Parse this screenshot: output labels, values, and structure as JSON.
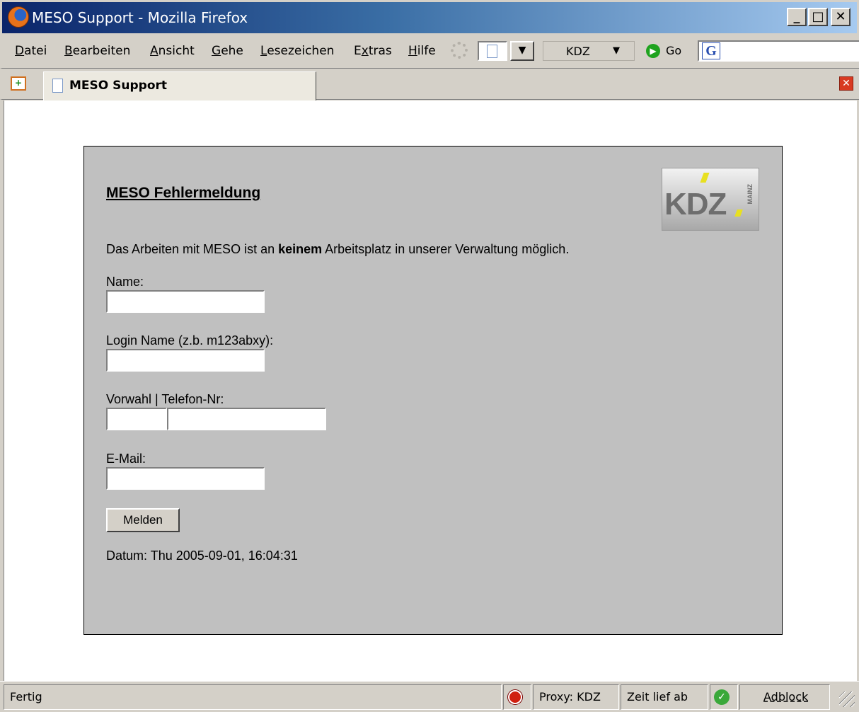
{
  "window": {
    "title": "MESO Support - Mozilla Firefox",
    "minimize_label": "_",
    "maximize_label": "□",
    "close_label": "✕"
  },
  "menu": {
    "items": [
      {
        "label": "Datei",
        "u": "D",
        "rest": "atei"
      },
      {
        "label": "Bearbeiten",
        "u": "B",
        "rest": "earbeiten"
      },
      {
        "label": "Ansicht",
        "u": "A",
        "rest": "nsicht"
      },
      {
        "label": "Gehe",
        "u": "G",
        "rest": "ehe"
      },
      {
        "label": "Lesezeichen",
        "u": "L",
        "rest": "esezeichen"
      },
      {
        "label": "Extras",
        "pre": "E",
        "u": "x",
        "rest": "tras"
      },
      {
        "label": "Hilfe",
        "u": "H",
        "rest": "ilfe"
      }
    ],
    "proxy_combo": "KDZ",
    "proxy_arrow": "▼",
    "page_dropdown_arrow": "▼",
    "go_label": "Go",
    "go_icon": "▶",
    "search_icon_glyph": "G"
  },
  "tabs": {
    "new_tab_glyph": "+",
    "active_tab": "MESO Support",
    "close_glyph": "✕"
  },
  "form": {
    "heading": "MESO Fehlermeldung",
    "intro_before": "Das Arbeiten mit MESO ist an ",
    "intro_bold": "keinem",
    "intro_after": " Arbeitsplatz in unserer Verwaltung möglich.",
    "name_label": "Name:",
    "name_value": "",
    "login_label": "Login Name (z.b. m123abxy):",
    "login_value": "",
    "phone_label": "Vorwahl | Telefon-Nr:",
    "area_code_value": "",
    "phone_value": "",
    "email_label": "E-Mail:",
    "email_value": "",
    "submit_label": "Melden",
    "date_text": "Datum: Thu 2005-09-01, 16:04:31",
    "logo_text": "KDZ",
    "logo_sub": "MAINZ"
  },
  "status": {
    "text": "Fertig",
    "proxy": "Proxy: KDZ",
    "timeout": "Zeit lief ab",
    "adblock": "Adblock"
  },
  "colors": {
    "panel_bg": "#c0c0c0",
    "chrome_bg": "#d4d0c8",
    "titlebar_start": "#0a246a",
    "titlebar_end": "#a6caf0"
  }
}
